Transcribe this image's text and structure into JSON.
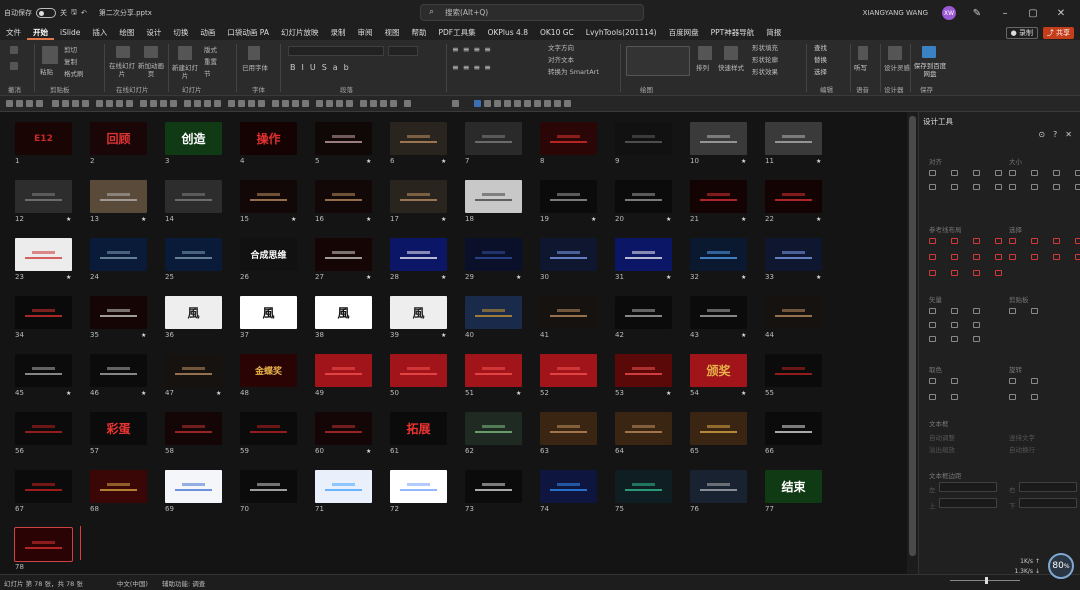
{
  "titlebar": {
    "autosave_label": "自动保存",
    "autosave_state": "关",
    "filename": "第二次分享.pptx",
    "search_placeholder": "搜索(Alt+Q)",
    "user_name": "XIANGYANG WANG",
    "user_initials": "XW"
  },
  "menu": [
    "文件",
    "开始",
    "iSlide",
    "插入",
    "绘图",
    "设计",
    "切换",
    "动画",
    "口袋动画 PA",
    "幻灯片放映",
    "录制",
    "审阅",
    "视图",
    "帮助",
    "PDF工具集",
    "OKPlus 4.8",
    "OK10 GC",
    "LvyhTools(201114)",
    "百度网盘",
    "PPT神器导航",
    "简报"
  ],
  "menu_active": "开始",
  "record_button": "● 录制",
  "share_button": "⤴ 共享",
  "ribbon": {
    "groups": [
      "撤消",
      "剪贴板",
      "在线幻灯片",
      "幻灯片",
      "字体",
      "段落",
      "绘图",
      "编辑",
      "语音",
      "设计器",
      "保存"
    ],
    "clipboard_items": [
      "粘贴",
      "剪切",
      "复制",
      "格式刷"
    ],
    "online_slides": [
      "在线幻灯片",
      "新加动画页"
    ],
    "slides_items": [
      "新建幻灯片",
      "版式",
      "重置",
      "节"
    ],
    "font_items": [
      "已用字体"
    ],
    "paragraph_items": [
      "文字方向",
      "对齐文本",
      "转换为 SmartArt"
    ],
    "drawing_items": [
      "排列",
      "快速样式",
      "形状填充",
      "形状轮廓",
      "形状效果"
    ],
    "editing_items": [
      "查找",
      "替换",
      "选择"
    ],
    "voice_items": [
      "听写"
    ],
    "designer_items": [
      "设计灵感"
    ],
    "save_items": [
      "保存到百度网盘"
    ]
  },
  "slides": [
    {
      "n": "1",
      "bg": "#1a0505",
      "fg": "#c8282a",
      "t": "E12",
      "star": false
    },
    {
      "n": "2",
      "bg": "#1a0606",
      "fg": "#d33",
      "t": "回顾",
      "star": false
    },
    {
      "n": "3",
      "bg": "#0f3a14",
      "fg": "#fff",
      "t": "创造",
      "star": false
    },
    {
      "n": "4",
      "bg": "#150303",
      "fg": "#e03030",
      "t": "操作",
      "star": false
    },
    {
      "n": "5",
      "bg": "#100707",
      "fg": "#d8b0b0",
      "t": "",
      "star": true
    },
    {
      "n": "6",
      "bg": "#2a241e",
      "fg": "#c96",
      "t": "",
      "star": true
    },
    {
      "n": "7",
      "bg": "#2a2a2a",
      "fg": "#888",
      "t": "",
      "star": false
    },
    {
      "n": "8",
      "bg": "#2a0606",
      "fg": "#e33",
      "t": "",
      "star": false
    },
    {
      "n": "9",
      "bg": "#111111",
      "fg": "#666",
      "t": "",
      "star": false
    },
    {
      "n": "10",
      "bg": "#3a3a3a",
      "fg": "#bbb",
      "t": "",
      "star": true
    },
    {
      "n": "11",
      "bg": "#3a3a3a",
      "fg": "#bbb",
      "t": "",
      "star": true
    },
    {
      "n": "12",
      "bg": "#2d2d2d",
      "fg": "#888",
      "t": "",
      "star": true
    },
    {
      "n": "13",
      "bg": "#5a4a3a",
      "fg": "#bbb",
      "t": "",
      "star": true
    },
    {
      "n": "14",
      "bg": "#2d2d2d",
      "fg": "#888",
      "t": "",
      "star": false
    },
    {
      "n": "15",
      "bg": "#120808",
      "fg": "#c96",
      "t": "",
      "star": true
    },
    {
      "n": "16",
      "bg": "#120808",
      "fg": "#c96",
      "t": "",
      "star": true
    },
    {
      "n": "17",
      "bg": "#2a241e",
      "fg": "#c96",
      "t": "",
      "star": true
    },
    {
      "n": "18",
      "bg": "#c8c8c8",
      "fg": "#333",
      "t": "",
      "star": false
    },
    {
      "n": "19",
      "bg": "#0b0b0b",
      "fg": "#aaa",
      "t": "",
      "star": true
    },
    {
      "n": "20",
      "bg": "#0b0b0b",
      "fg": "#aaa",
      "t": "",
      "star": true
    },
    {
      "n": "21",
      "bg": "#140303",
      "fg": "#e33",
      "t": "",
      "star": true
    },
    {
      "n": "22",
      "bg": "#140303",
      "fg": "#e33",
      "t": "",
      "star": true
    },
    {
      "n": "23",
      "bg": "#ececec",
      "fg": "#c22",
      "t": "",
      "star": true
    },
    {
      "n": "24",
      "bg": "#0a1b3a",
      "fg": "#8ab",
      "t": "",
      "star": false
    },
    {
      "n": "25",
      "bg": "#0a1b3a",
      "fg": "#8ab",
      "t": "",
      "star": false
    },
    {
      "n": "26",
      "bg": "#111111",
      "fg": "#fff",
      "t": "合成思维",
      "star": false
    },
    {
      "n": "27",
      "bg": "#160505",
      "fg": "#ddd",
      "t": "",
      "star": true
    },
    {
      "n": "28",
      "bg": "#0b1766",
      "fg": "#fff",
      "t": "",
      "star": true
    },
    {
      "n": "29",
      "bg": "#0a0f2a",
      "fg": "#35a",
      "t": "",
      "star": true
    },
    {
      "n": "30",
      "bg": "#0e1630",
      "fg": "#8af",
      "t": "",
      "star": false
    },
    {
      "n": "31",
      "bg": "#0b1766",
      "fg": "#fff",
      "t": "",
      "star": true
    },
    {
      "n": "32",
      "bg": "#0a1930",
      "fg": "#5af",
      "t": "",
      "star": true
    },
    {
      "n": "33",
      "bg": "#0e1630",
      "fg": "#8af",
      "t": "",
      "star": true
    },
    {
      "n": "34",
      "bg": "#0a0a0a",
      "fg": "#e33",
      "t": "",
      "star": false
    },
    {
      "n": "35",
      "bg": "#160505",
      "fg": "#ddd",
      "t": "",
      "star": true
    },
    {
      "n": "36",
      "bg": "#eeeeee",
      "fg": "#222",
      "t": "風",
      "star": false
    },
    {
      "n": "37",
      "bg": "#ffffff",
      "fg": "#111",
      "t": "風",
      "star": false
    },
    {
      "n": "38",
      "bg": "#ffffff",
      "fg": "#111",
      "t": "風",
      "star": false
    },
    {
      "n": "39",
      "bg": "#eeeeee",
      "fg": "#222",
      "t": "風",
      "star": true
    },
    {
      "n": "40",
      "bg": "#1a2a4a",
      "fg": "#d9a030",
      "t": "",
      "star": false
    },
    {
      "n": "41",
      "bg": "#161210",
      "fg": "#c96",
      "t": "",
      "star": false
    },
    {
      "n": "42",
      "bg": "#0b0b0b",
      "fg": "#bbb",
      "t": "",
      "star": false
    },
    {
      "n": "43",
      "bg": "#0b0b0b",
      "fg": "#bbb",
      "t": "",
      "star": true
    },
    {
      "n": "44",
      "bg": "#161210",
      "fg": "#c96",
      "t": "",
      "star": false
    },
    {
      "n": "45",
      "bg": "#0b0b0b",
      "fg": "#bbb",
      "t": "",
      "star": true
    },
    {
      "n": "46",
      "bg": "#0b0b0b",
      "fg": "#bbb",
      "t": "",
      "star": true
    },
    {
      "n": "47",
      "bg": "#161210",
      "fg": "#c96",
      "t": "",
      "star": true
    },
    {
      "n": "48",
      "bg": "#2a0404",
      "fg": "#e6b34a",
      "t": "金蝶奖",
      "star": false
    },
    {
      "n": "49",
      "bg": "#a0141a",
      "fg": "#f55",
      "t": "",
      "star": false
    },
    {
      "n": "50",
      "bg": "#a0141a",
      "fg": "#f55",
      "t": "",
      "star": false
    },
    {
      "n": "51",
      "bg": "#a0141a",
      "fg": "#f55",
      "t": "",
      "star": true
    },
    {
      "n": "52",
      "bg": "#a0141a",
      "fg": "#f55",
      "t": "",
      "star": false
    },
    {
      "n": "53",
      "bg": "#5a0808",
      "fg": "#f55",
      "t": "",
      "star": true
    },
    {
      "n": "54",
      "bg": "#a0141a",
      "fg": "#e6b34a",
      "t": "颁奖",
      "star": true
    },
    {
      "n": "55",
      "bg": "#0b0b0b",
      "fg": "#c22",
      "t": "",
      "star": false
    },
    {
      "n": "56",
      "bg": "#0b0b0b",
      "fg": "#c22",
      "t": "",
      "star": false
    },
    {
      "n": "57",
      "bg": "#0b0b0b",
      "fg": "#e33",
      "t": "彩蛋",
      "star": false
    },
    {
      "n": "58",
      "bg": "#140606",
      "fg": "#c33",
      "t": "",
      "star": false
    },
    {
      "n": "59",
      "bg": "#0b0b0b",
      "fg": "#c22",
      "t": "",
      "star": false
    },
    {
      "n": "60",
      "bg": "#140606",
      "fg": "#c33",
      "t": "",
      "star": true
    },
    {
      "n": "61",
      "bg": "#0b0b0b",
      "fg": "#e33",
      "t": "拓展",
      "star": false
    },
    {
      "n": "62",
      "bg": "#1e2a22",
      "fg": "#8c8",
      "t": "",
      "star": false
    },
    {
      "n": "63",
      "bg": "#3a2412",
      "fg": "#c96",
      "t": "",
      "star": false
    },
    {
      "n": "64",
      "bg": "#3a2412",
      "fg": "#c96",
      "t": "",
      "star": false
    },
    {
      "n": "65",
      "bg": "#3a2412",
      "fg": "#e6b34a",
      "t": "",
      "star": false
    },
    {
      "n": "66",
      "bg": "#0b0b0b",
      "fg": "#eee",
      "t": "",
      "star": false
    },
    {
      "n": "67",
      "bg": "#0b0b0b",
      "fg": "#d22",
      "t": "",
      "star": false
    },
    {
      "n": "68",
      "bg": "#3a0606",
      "fg": "#e6b34a",
      "t": "",
      "star": false
    },
    {
      "n": "69",
      "bg": "#f4f6fa",
      "fg": "#36c",
      "t": "",
      "star": false
    },
    {
      "n": "70",
      "bg": "#0b0b0b",
      "fg": "#ddd",
      "t": "",
      "star": false
    },
    {
      "n": "71",
      "bg": "#e9f0fb",
      "fg": "#39f",
      "t": "",
      "star": false
    },
    {
      "n": "72",
      "bg": "#ffffff",
      "fg": "#69f",
      "t": "",
      "star": false
    },
    {
      "n": "73",
      "bg": "#0b0b0b",
      "fg": "#eee",
      "t": "",
      "star": false
    },
    {
      "n": "74",
      "bg": "#0e1640",
      "fg": "#39f",
      "t": "",
      "star": false
    },
    {
      "n": "75",
      "bg": "#0e1e22",
      "fg": "#3c9",
      "t": "",
      "star": false
    },
    {
      "n": "76",
      "bg": "#182230",
      "fg": "#bbb",
      "t": "",
      "star": false
    },
    {
      "n": "77",
      "bg": "#0f3a14",
      "fg": "#fff",
      "t": "结束",
      "star": false
    },
    {
      "n": "78",
      "bg": "#2a0404",
      "fg": "#e33",
      "t": "",
      "star": false
    }
  ],
  "design_pane": {
    "title": "设计工具",
    "sections": [
      "对齐",
      "大小",
      "参考线布局",
      "选择",
      "矢量",
      "剪贴板",
      "取色",
      "旋转",
      "文本框",
      "文本框边距"
    ],
    "textbox_options": [
      "自动调整",
      "竖排文字",
      "溢出缩放",
      "自动换行"
    ],
    "margin_labels": [
      "左",
      "右",
      "上",
      "下"
    ]
  },
  "status": {
    "slide_info": "幻灯片 第 78 张，共 78 张",
    "language": "中文(中国)",
    "accessibility": "辅助功能: 调查",
    "zoom": "80",
    "zoom_unit": "%",
    "net_up": "1K/s",
    "net_down": "1.3K/s"
  }
}
